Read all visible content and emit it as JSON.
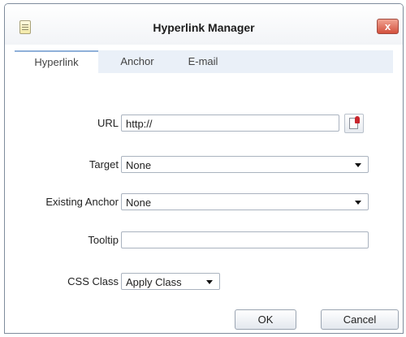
{
  "window": {
    "title": "Hyperlink Manager",
    "close_label": "x"
  },
  "tabs": [
    {
      "label": "Hyperlink",
      "active": true
    },
    {
      "label": "Anchor",
      "active": false
    },
    {
      "label": "E-mail",
      "active": false
    }
  ],
  "form": {
    "url": {
      "label": "URL",
      "value": "http://"
    },
    "target": {
      "label": "Target",
      "value": "None"
    },
    "existing_anchor": {
      "label": "Existing Anchor",
      "value": "None"
    },
    "tooltip": {
      "label": "Tooltip",
      "value": ""
    },
    "css_class": {
      "label": "CSS Class",
      "value": "Apply Class"
    }
  },
  "buttons": {
    "ok": "OK",
    "cancel": "Cancel"
  },
  "icons": {
    "window": "document-icon",
    "url_browse": "document-browse-icon",
    "close": "close-icon"
  },
  "colors": {
    "tab_strip": "#eaf0f8",
    "close_button": "#d3513d"
  }
}
